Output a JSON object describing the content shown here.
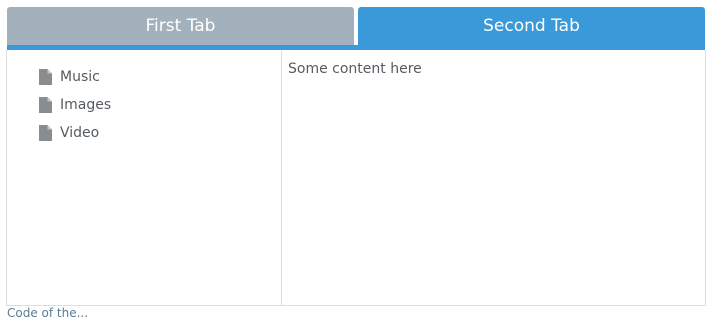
{
  "tabs": [
    {
      "label": "First Tab",
      "active": false
    },
    {
      "label": "Second Tab",
      "active": true
    }
  ],
  "colors": {
    "inactive_tab": "#a2b1bc",
    "active_tab": "#3a9ad9",
    "border": "#d9dfe3",
    "text": "#555b60"
  },
  "sidebar": {
    "items": [
      {
        "label": "Music",
        "icon": "file-icon"
      },
      {
        "label": "Images",
        "icon": "file-icon"
      },
      {
        "label": "Video",
        "icon": "file-icon"
      }
    ]
  },
  "content": {
    "text": "Some content here"
  },
  "footer": {
    "text": "Code of the..."
  }
}
